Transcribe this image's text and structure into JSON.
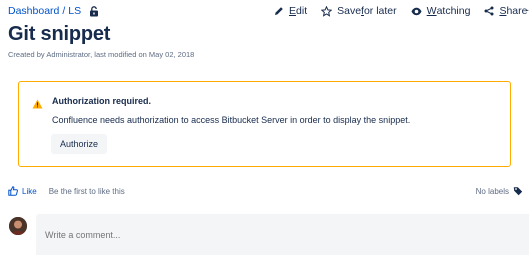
{
  "breadcrumb": {
    "items": [
      "Dashboard",
      "LS"
    ],
    "separator": "/"
  },
  "actions": {
    "edit": {
      "prefix": "",
      "underlined": "E",
      "suffix": "dit"
    },
    "save": {
      "prefix": "Save ",
      "underlined": "f",
      "suffix": "or later"
    },
    "watching": {
      "prefix": "",
      "underlined": "W",
      "suffix": "atching"
    },
    "share": {
      "prefix": "",
      "underlined": "S",
      "suffix": "hare"
    },
    "more": "···"
  },
  "page": {
    "title": "Git snippet",
    "byline": "Created by Administrator, last modified on May 02, 2018"
  },
  "warning": {
    "title": "Authorization required.",
    "message": "Confluence needs authorization to access Bitbucket Server in order to display the snippet.",
    "button_label": "Authorize"
  },
  "likes": {
    "like_label": "Like",
    "hint": "Be the first to like this"
  },
  "labels": {
    "text": "No labels"
  },
  "comment": {
    "placeholder": "Write a comment..."
  },
  "colors": {
    "link": "#0052cc",
    "warning_border": "#ffab00",
    "text": "#172b4d",
    "muted": "#5e6c84"
  },
  "icons": [
    "lock-icon",
    "pencil-icon",
    "star-icon",
    "eye-icon",
    "share-icon",
    "warning-icon",
    "thumbs-up-icon",
    "tag-icon",
    "user-avatar"
  ]
}
